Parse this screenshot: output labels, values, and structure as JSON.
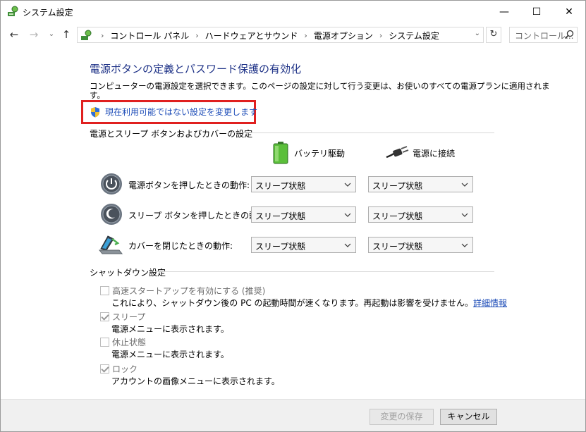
{
  "window": {
    "title": "システム設定",
    "minimize": "—",
    "maximize": "☐",
    "close": "✕"
  },
  "nav": {
    "back": "←",
    "forward": "→",
    "recent": "⌄",
    "up": "↑",
    "breadcrumbs": [
      "コントロール パネル",
      "ハードウェアとサウンド",
      "電源オプション",
      "システム設定"
    ],
    "refresh": "↻",
    "search_placeholder": "コントロール..."
  },
  "main": {
    "title": "電源ボタンの定義とパスワード保護の有効化",
    "description_line1": "コンピューターの電源設定を選択できます。このページの設定に対して行う変更は、お使いのすべての電源プランに適用されま",
    "description_line2": "す。",
    "change_link": "現在利用可能ではない設定を変更します"
  },
  "power_section": {
    "header": "電源とスリープ ボタンおよびカバーの設定",
    "col_battery": "バッテリ駆動",
    "col_ac": "電源に接続",
    "rows": [
      {
        "label": "電源ボタンを押したときの動作:",
        "battery": "スリープ状態",
        "ac": "スリープ状態",
        "icon": "power-button-icon"
      },
      {
        "label": "スリープ ボタンを押したときの動作:",
        "battery": "スリープ状態",
        "ac": "スリープ状態",
        "icon": "sleep-button-icon"
      },
      {
        "label": "カバーを閉じたときの動作:",
        "battery": "スリープ状態",
        "ac": "スリープ状態",
        "icon": "laptop-lid-icon"
      }
    ]
  },
  "shutdown_section": {
    "header": "シャットダウン設定",
    "items": [
      {
        "label": "高速スタートアップを有効にする (推奨)",
        "checked": false,
        "desc": "これにより、シャットダウン後の PC の起動時間が速くなります。再起動は影響を受けません。",
        "link": "詳細情報"
      },
      {
        "label": "スリープ",
        "checked": true,
        "desc": "電源メニューに表示されます。"
      },
      {
        "label": "休止状態",
        "checked": false,
        "desc": "電源メニューに表示されます。"
      },
      {
        "label": "ロック",
        "checked": true,
        "desc": "アカウントの画像メニューに表示されます。"
      }
    ]
  },
  "footer": {
    "save": "変更の保存",
    "cancel": "キャンセル"
  },
  "colors": {
    "title_blue": "#1e3287",
    "link_blue": "#1e4db8",
    "highlight_red": "#e0201f"
  }
}
